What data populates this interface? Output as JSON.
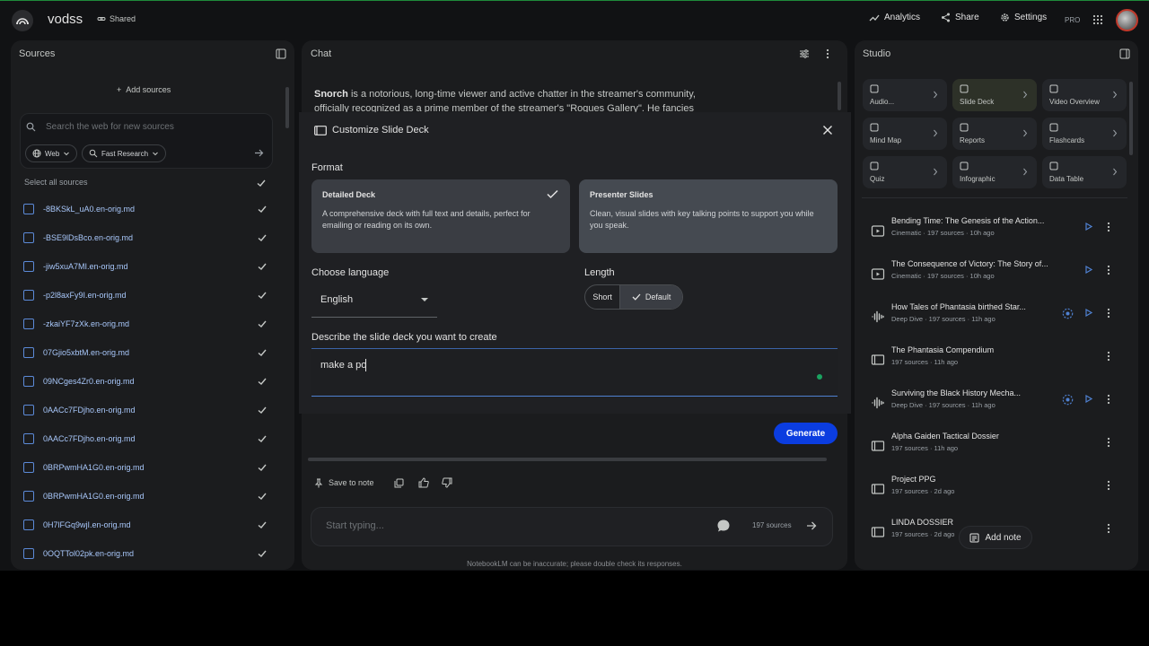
{
  "header": {
    "title": "vodss",
    "shared_label": "Shared",
    "analytics_label": "Analytics",
    "share_label": "Share",
    "settings_label": "Settings",
    "pro_badge": "PRO"
  },
  "sources": {
    "heading": "Sources",
    "add_label": "Add sources",
    "search_placeholder": "Search the web for new sources",
    "web_chip": "Web",
    "research_chip": "Fast Research",
    "select_all": "Select all sources",
    "items": [
      "-8BKSkL_uA0.en-orig.md",
      "-BSE9lDsBco.en-orig.md",
      "-jiw5xuA7MI.en-orig.md",
      "-p2l8axFy9I.en-orig.md",
      "-zkaiYF7zXk.en-orig.md",
      "07Gjio5xbtM.en-orig.md",
      "09NCges4Zr0.en-orig.md",
      "0AACc7FDjho.en-orig.md",
      "0AACc7FDjho.en-orig.md",
      "0BRPwmHA1G0.en-orig.md",
      "0BRPwmHA1G0.en-orig.md",
      "0H7lFGq9wjI.en-orig.md",
      "0OQTTol02pk.en-orig.md"
    ]
  },
  "chat": {
    "heading": "Chat",
    "message_bold": "Snorch",
    "message_rest": " is a notorious, long-time viewer and active chatter in the streamer's community, officially recognized as a prime member of the streamer's \"Rogues Gallery\". He fancies",
    "save_to_note": "Save to note",
    "input_placeholder": "Start typing...",
    "source_count": "197 sources",
    "disclaimer": "NotebookLM can be inaccurate; please double check its responses."
  },
  "modal": {
    "title": "Customize Slide Deck",
    "format_label": "Format",
    "formats": [
      {
        "title": "Detailed Deck",
        "desc": "A comprehensive deck with full text and details, perfect for emailing or reading on its own.",
        "selected": true
      },
      {
        "title": "Presenter Slides",
        "desc": "Clean, visual slides with key talking points to support you while you speak.",
        "selected": false
      }
    ],
    "language_label": "Choose language",
    "language_value": "English",
    "length_label": "Length",
    "length_short": "Short",
    "length_default": "Default",
    "describe_label": "Describe the slide deck you want to create",
    "describe_value": "make a po",
    "generate_label": "Generate"
  },
  "studio": {
    "heading": "Studio",
    "tiles": [
      "Audio...",
      "Slide Deck",
      "Video Overview",
      "Mind Map",
      "Reports",
      "Flashcards",
      "Quiz",
      "Infographic",
      "Data Table"
    ],
    "artifacts": [
      {
        "title": "Bending Time: The Genesis of the Action...",
        "meta": "Cinematic · 197 sources · 10h ago",
        "icon": "video-icon"
      },
      {
        "title": "The Consequence of Victory: The Story of...",
        "meta": "Cinematic · 197 sources · 10h ago",
        "icon": "video-icon"
      },
      {
        "title": "How Tales of Phantasia birthed Star...",
        "meta": "Deep Dive · 197 sources · 11h ago",
        "icon": "audio-icon"
      },
      {
        "title": "The Phantasia Compendium",
        "meta": "197 sources · 11h ago",
        "icon": "slides-icon"
      },
      {
        "title": "Surviving the Black History Mecha...",
        "meta": "Deep Dive · 197 sources · 11h ago",
        "icon": "audio-icon"
      },
      {
        "title": "Alpha Gaiden Tactical Dossier",
        "meta": "197 sources · 11h ago",
        "icon": "slides-icon"
      },
      {
        "title": "Project PPG",
        "meta": "197 sources · 2d ago",
        "icon": "slides-icon"
      },
      {
        "title": "LINDA DOSSIER",
        "meta": "197 sources · 2d ago",
        "icon": "slides-icon"
      }
    ],
    "add_note": "Add note"
  }
}
